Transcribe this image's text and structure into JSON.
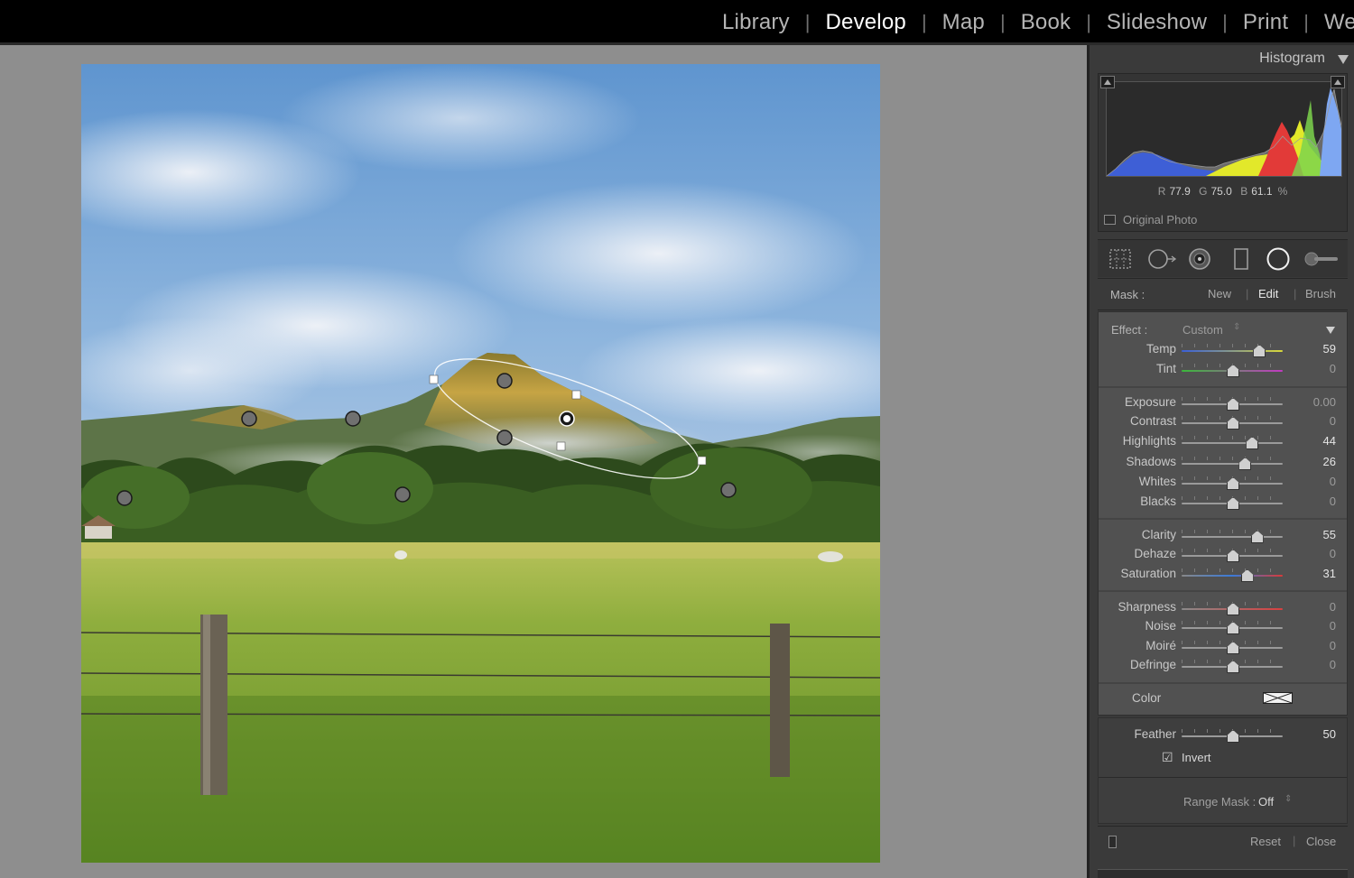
{
  "modules": [
    "Library",
    "Develop",
    "Map",
    "Book",
    "Slideshow",
    "Print",
    "Web"
  ],
  "active_module": "Develop",
  "histogram": {
    "title": "Histogram",
    "r_label": "R",
    "r_value": "77.9",
    "g_label": "G",
    "g_value": "75.0",
    "b_label": "B",
    "b_value": "61.1",
    "percent": "%",
    "original_photo": "Original Photo"
  },
  "tools": [
    "crop-overlay-icon",
    "spot-removal-icon",
    "red-eye-icon",
    "graduated-filter-icon",
    "radial-filter-icon",
    "adjustment-brush-icon"
  ],
  "mask": {
    "label": "Mask :",
    "new": "New",
    "edit": "Edit",
    "brush": "Brush"
  },
  "effect": {
    "label": "Effect :",
    "value": "Custom"
  },
  "sliders": [
    {
      "label": "Temp",
      "value": "59",
      "pos": 0.76
    },
    {
      "label": "Tint",
      "value": "0",
      "pos": 0.5
    },
    {
      "label": "Exposure",
      "value": "0.00",
      "pos": 0.5
    },
    {
      "label": "Contrast",
      "value": "0",
      "pos": 0.5
    },
    {
      "label": "Highlights",
      "value": "44",
      "pos": 0.69
    },
    {
      "label": "Shadows",
      "value": "26",
      "pos": 0.62
    },
    {
      "label": "Whites",
      "value": "0",
      "pos": 0.5
    },
    {
      "label": "Blacks",
      "value": "0",
      "pos": 0.5
    },
    {
      "label": "Clarity",
      "value": "55",
      "pos": 0.74
    },
    {
      "label": "Dehaze",
      "value": "0",
      "pos": 0.5
    },
    {
      "label": "Saturation",
      "value": "31",
      "pos": 0.64
    },
    {
      "label": "Sharpness",
      "value": "0",
      "pos": 0.5
    },
    {
      "label": "Noise",
      "value": "0",
      "pos": 0.5
    },
    {
      "label": "Moiré",
      "value": "0",
      "pos": 0.5
    },
    {
      "label": "Defringe",
      "value": "0",
      "pos": 0.5
    }
  ],
  "color": {
    "label": "Color"
  },
  "feather": {
    "label": "Feather",
    "value": "50",
    "pos": 0.5
  },
  "invert": {
    "label": "Invert",
    "checked": true
  },
  "range_mask": {
    "label": "Range Mask :",
    "value": "Off"
  },
  "footer": {
    "reset": "Reset",
    "close": "Close"
  }
}
